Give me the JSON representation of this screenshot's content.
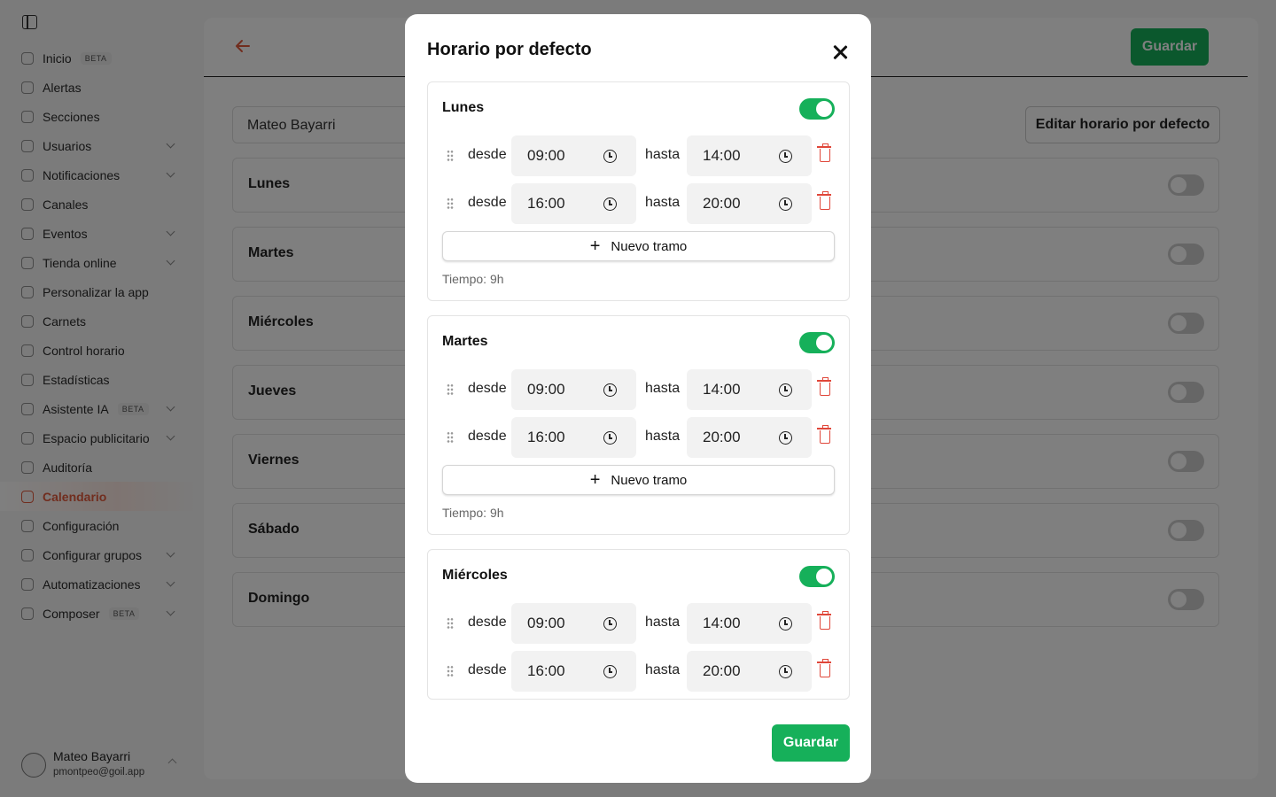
{
  "sidebar": {
    "items": [
      {
        "label": "Inicio",
        "badge": "BETA",
        "icon": "home-icon"
      },
      {
        "label": "Alertas",
        "icon": "bell-icon"
      },
      {
        "label": "Secciones",
        "icon": "layers-icon"
      },
      {
        "label": "Usuarios",
        "icon": "users-icon",
        "expandable": true
      },
      {
        "label": "Notificaciones",
        "icon": "message-icon",
        "expandable": true
      },
      {
        "label": "Canales",
        "icon": "megaphone-icon"
      },
      {
        "label": "Eventos",
        "icon": "ticket-icon",
        "expandable": true
      },
      {
        "label": "Tienda online",
        "icon": "store-icon",
        "expandable": true
      },
      {
        "label": "Personalizar la app",
        "icon": "palette-icon"
      },
      {
        "label": "Carnets",
        "icon": "card-icon"
      },
      {
        "label": "Control horario",
        "icon": "clock-icon"
      },
      {
        "label": "Estadísticas",
        "icon": "chart-icon"
      },
      {
        "label": "Asistente IA",
        "badge": "BETA",
        "icon": "sparkle-icon",
        "expandable": true
      },
      {
        "label": "Espacio publicitario",
        "icon": "phone-icon",
        "expandable": true
      },
      {
        "label": "Auditoría",
        "icon": "audit-icon"
      },
      {
        "label": "Calendario",
        "icon": "calendar-icon",
        "active": true
      },
      {
        "label": "Configuración",
        "icon": "settings-icon"
      },
      {
        "label": "Configurar grupos",
        "icon": "group-icon",
        "expandable": true
      },
      {
        "label": "Automatizaciones",
        "icon": "workflow-icon",
        "expandable": true
      },
      {
        "label": "Composer",
        "badge": "BETA",
        "icon": "sparkle-icon",
        "expandable": true
      }
    ],
    "user": {
      "name": "Mateo Bayarri",
      "email": "pmontpeo@goil.app"
    }
  },
  "main": {
    "save_label": "Guardar",
    "selected_user": "Mateo Bayarri",
    "edit_default_label": "Editar horario por defecto",
    "days": [
      "Lunes",
      "Martes",
      "Miércoles",
      "Jueves",
      "Viernes",
      "Sábado",
      "Domingo"
    ]
  },
  "modal": {
    "title": "Horario por defecto",
    "from_label": "desde",
    "to_label": "hasta",
    "add_slot_label": "Nuevo tramo",
    "save_label": "Guardar",
    "days": [
      {
        "name": "Lunes",
        "enabled": true,
        "slots": [
          {
            "from": "09:00",
            "to": "14:00"
          },
          {
            "from": "16:00",
            "to": "20:00"
          }
        ],
        "total": "Tiempo: 9h"
      },
      {
        "name": "Martes",
        "enabled": true,
        "slots": [
          {
            "from": "09:00",
            "to": "14:00"
          },
          {
            "from": "16:00",
            "to": "20:00"
          }
        ],
        "total": "Tiempo: 9h"
      },
      {
        "name": "Miércoles",
        "enabled": true,
        "slots": [
          {
            "from": "09:00",
            "to": "14:00"
          },
          {
            "from": "16:00",
            "to": "20:00"
          }
        ]
      }
    ]
  },
  "colors": {
    "accent": "#16b05a",
    "active_nav": "#e25a3c",
    "danger": "#e0473a"
  }
}
